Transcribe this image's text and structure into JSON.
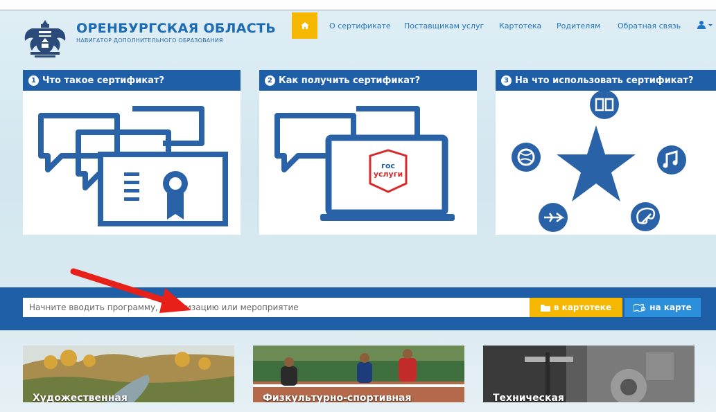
{
  "header": {
    "title": "ОРЕНБУРГСКАЯ ОБЛАСТЬ",
    "subtitle": "НАВИГАТОР ДОПОЛНИТЕЛЬНОГО ОБРАЗОВАНИЯ",
    "home_icon": "home-icon",
    "nav": [
      {
        "label": "О сертификате"
      },
      {
        "label": "Поставщикам услуг"
      },
      {
        "label": "Картотека"
      },
      {
        "label": "Родителям"
      },
      {
        "label": "Обратная связь"
      }
    ],
    "user_icon": "user-icon",
    "accent": "#f5b700",
    "brand_color": "#1d6bb3"
  },
  "cards": [
    {
      "num": "1",
      "title": "Что такое сертификат?"
    },
    {
      "num": "2",
      "title": "Как получить сертификат?",
      "gos_top": "гос",
      "gos_bottom": "услуги"
    },
    {
      "num": "3",
      "title": "На что использовать сертификат?"
    }
  ],
  "search": {
    "placeholder": "Начните вводить программу, организацию или мероприятие",
    "catalog_label": "в картотеке",
    "map_label": "на карте"
  },
  "categories": [
    {
      "label": "Художественная"
    },
    {
      "label": "Физкультурно-спортивная"
    },
    {
      "label": "Техническая"
    }
  ],
  "colors": {
    "card_header": "#1e5fa8",
    "icon_blue": "#2a62a8",
    "arrow": "#e8201a",
    "map_button": "#2b8fdc"
  }
}
